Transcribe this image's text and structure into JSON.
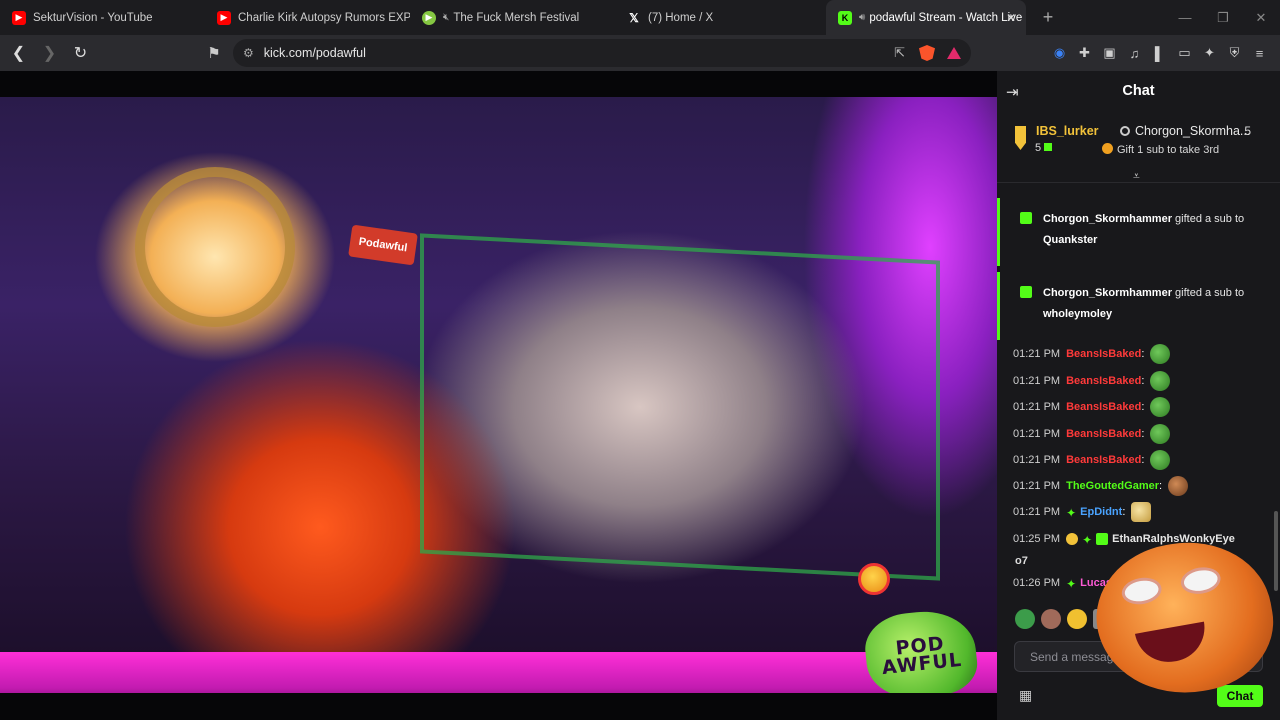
{
  "browser": {
    "tabs": [
      {
        "label": "SekturVision - YouTube",
        "favicon": "youtube-icon",
        "color": "#ff0000"
      },
      {
        "label": "Charlie Kirk Autopsy Rumors EXPLAI",
        "favicon": "youtube-icon",
        "color": "#ff0000"
      },
      {
        "label": "The Fuck Mersh Festival",
        "favicon": "rumble-icon",
        "color": "#85c742"
      },
      {
        "label": "(7) Home / X",
        "favicon": "x-icon",
        "color": "#ffffff"
      },
      {
        "label": "podawful Stream - Watch Live",
        "favicon": "kick-icon",
        "color": "#53fc18"
      }
    ],
    "url": "kick.com/podawful"
  },
  "video": {
    "cap_text": "Podawful",
    "logo_text": "POD AWFUL"
  },
  "chat": {
    "header": "Chat",
    "leaderboard": {
      "first_name": "IBS_lurker",
      "first_count": "5",
      "second_name": "Chorgon_Skormha...",
      "second_count": "5",
      "gift_prompt": "Gift 1 sub to take 3rd"
    },
    "gifts": [
      {
        "gifter": "Chorgon_Skormhammer",
        "text": "gifted a sub to",
        "recipient": "Quankster"
      },
      {
        "gifter": "Chorgon_Skormhammer",
        "text": "gifted a sub to",
        "recipient": "wholeymoley"
      }
    ],
    "messages": [
      {
        "time": "01:21 PM",
        "user": "BeansIsBaked",
        "color": "#ff3a3a",
        "emote": "green"
      },
      {
        "time": "01:21 PM",
        "user": "BeansIsBaked",
        "color": "#ff3a3a",
        "emote": "green"
      },
      {
        "time": "01:21 PM",
        "user": "BeansIsBaked",
        "color": "#ff3a3a",
        "emote": "green"
      },
      {
        "time": "01:21 PM",
        "user": "BeansIsBaked",
        "color": "#ff3a3a",
        "emote": "green"
      },
      {
        "time": "01:21 PM",
        "user": "BeansIsBaked",
        "color": "#ff3a3a",
        "emote": "green"
      },
      {
        "time": "01:21 PM",
        "user": "TheGoutedGamer",
        "color": "#53fc18",
        "emote": "brown"
      },
      {
        "time": "01:21 PM",
        "user": "EpDidnt",
        "color": "#4aa3ff",
        "emote": "hand"
      },
      {
        "time": "01:25 PM",
        "user": "EthanRalphsWonkyEye",
        "color": "#e6e6e6",
        "emote": ""
      },
      {
        "time": "01:26 PM",
        "user": "LucasMalager",
        "color": "#ff5ad6",
        "emote": ""
      }
    ],
    "extra_line": "o7",
    "composer_placeholder": "Send a message",
    "send_label": "Chat"
  }
}
